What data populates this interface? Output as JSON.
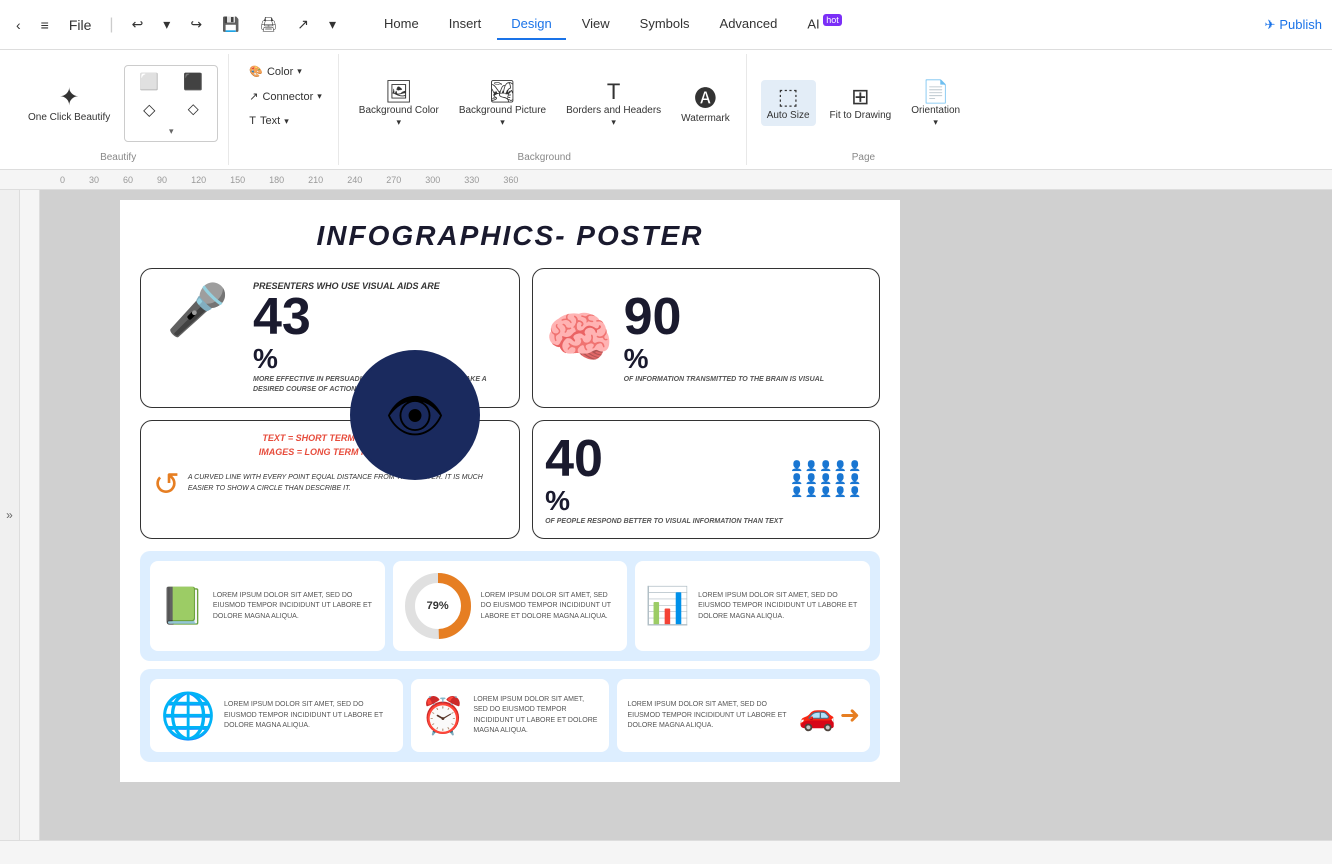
{
  "titlebar": {
    "back_btn": "‹",
    "menu_btn": "≡",
    "file_btn": "File",
    "undo_btn": "↩",
    "redo_btn": "↪",
    "save_btn": "💾",
    "print_btn": "🖨",
    "export_btn": "↗",
    "more_btn": "▾",
    "publish_btn": "Publish"
  },
  "nav": {
    "tabs": [
      "Home",
      "Insert",
      "Design",
      "View",
      "Symbols",
      "Advanced",
      "AI"
    ],
    "active_tab": "Design",
    "ai_badge": "hot"
  },
  "ribbon": {
    "beautify_label": "One Click Beautify",
    "shapes_label": "Beautify",
    "background_section_label": "Background",
    "page_section_label": "Page",
    "color_btn": "Color",
    "connector_btn": "Connector",
    "text_btn": "Text",
    "bg_color_btn": "Background Color",
    "bg_picture_btn": "Background Picture",
    "borders_btn": "Borders and Headers",
    "watermark_btn": "Watermark",
    "auto_size_btn": "Auto Size",
    "fit_drawing_btn": "Fit to Drawing",
    "orientation_btn": "Orientation"
  },
  "poster": {
    "title": "INFOGRAPHICS- POSTER",
    "stat1": {
      "subtitle": "Presenters who use visual aids are",
      "number": "43",
      "percent": "%",
      "desc": "More effective in persuading audience members to take a desired course of action"
    },
    "stat2": {
      "number": "90",
      "percent": "%",
      "desc": "Of information transmitted to the brain is visual"
    },
    "memory_title": "TEXT = SHORT TERM MEMORY",
    "memory_subtitle": "IMAGES = LONG TERM MEMORY",
    "memory_desc": "A curved line with every point equal distance from the center. It is much easier to show a circle than describe it.",
    "stat3": {
      "number": "40",
      "percent": "%",
      "desc": "Of people respond better to visual information than text"
    },
    "lorem": "LOREM IPSUM DOLOR SIT AMET, SED DO EIUSMOD TEMPOR INCIDIDUNT UT LABORE ET DOLORE MAGNA ALIQUA.",
    "percent_chart": "79%",
    "stat_section2_lorem": "LOREM IPSUM DOLOR SIT AMET, SED DO EIUSMOD TEMPOR INCIDIDUNT UT LABORE ET DOLORE MAGNA ALIQUA."
  },
  "ruler": {
    "marks": [
      "0",
      "30",
      "60",
      "90",
      "120",
      "150",
      "180",
      "210",
      "240",
      "270",
      "300",
      "330",
      "360"
    ]
  }
}
